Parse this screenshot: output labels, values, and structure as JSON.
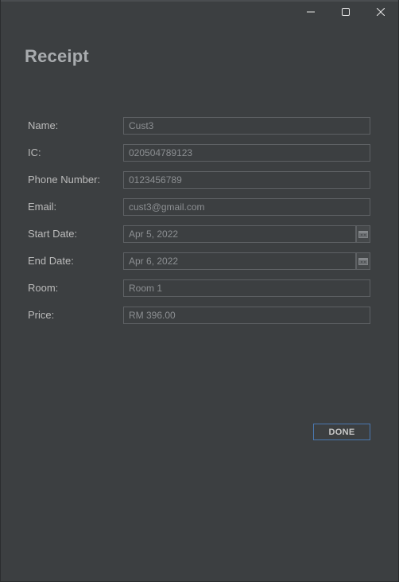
{
  "window": {
    "controls": {
      "minimize": "minimize-icon",
      "maximize": "maximize-icon",
      "close": "close-icon"
    }
  },
  "heading": "Receipt",
  "form": {
    "name": {
      "label": "Name:",
      "value": "Cust3"
    },
    "ic": {
      "label": "IC:",
      "value": "020504789123"
    },
    "phone": {
      "label": "Phone Number:",
      "value": "0123456789"
    },
    "email": {
      "label": "Email:",
      "value": "cust3@gmail.com"
    },
    "start_date": {
      "label": "Start Date:",
      "value": "Apr 5, 2022",
      "icon": "calendar-icon"
    },
    "end_date": {
      "label": "End Date:",
      "value": "Apr 6, 2022",
      "icon": "calendar-icon"
    },
    "room": {
      "label": "Room:",
      "value": "Room 1"
    },
    "price": {
      "label": "Price:",
      "value": "RM 396.00"
    }
  },
  "actions": {
    "done_label": "DONE"
  },
  "colors": {
    "background": "#3c3f41",
    "field_border": "#5e6164",
    "label_text": "#bbbbbb",
    "field_text": "#8c8f92",
    "heading_text": "#a9acaf",
    "done_border": "#4a78b0"
  }
}
